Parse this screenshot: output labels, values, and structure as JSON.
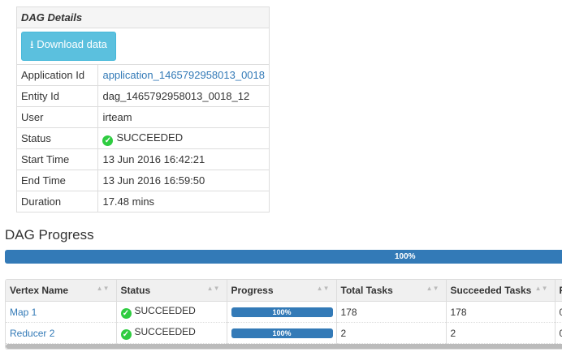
{
  "details": {
    "title": "DAG Details",
    "download_label": "Download data",
    "rows": [
      {
        "label": "Application Id",
        "value": "application_1465792958013_0018"
      },
      {
        "label": "Entity Id",
        "value": "dag_1465792958013_0018_12"
      },
      {
        "label": "User",
        "value": "irteam"
      },
      {
        "label": "Status",
        "value": "SUCCEEDED"
      },
      {
        "label": "Start Time",
        "value": "13 Jun 2016 16:42:21"
      },
      {
        "label": "End Time",
        "value": "13 Jun 2016 16:59:50"
      },
      {
        "label": "Duration",
        "value": "17.48 mins"
      }
    ]
  },
  "progress": {
    "title": "DAG Progress",
    "percent_label": "100%",
    "percent": 100
  },
  "vertices": {
    "columns": [
      "Vertex Name",
      "Status",
      "Progress",
      "Total Tasks",
      "Succeeded Tasks",
      "F"
    ],
    "rows": [
      {
        "name": "Map 1",
        "status": "SUCCEEDED",
        "progress": "100%",
        "total": "178",
        "succeeded": "178",
        "next": "0"
      },
      {
        "name": "Reducer 2",
        "status": "SUCCEEDED",
        "progress": "100%",
        "total": "2",
        "succeeded": "2",
        "next": "0"
      }
    ]
  },
  "colors": {
    "primary": "#337ab7",
    "info": "#5bc0de",
    "success": "#2ecc40"
  }
}
